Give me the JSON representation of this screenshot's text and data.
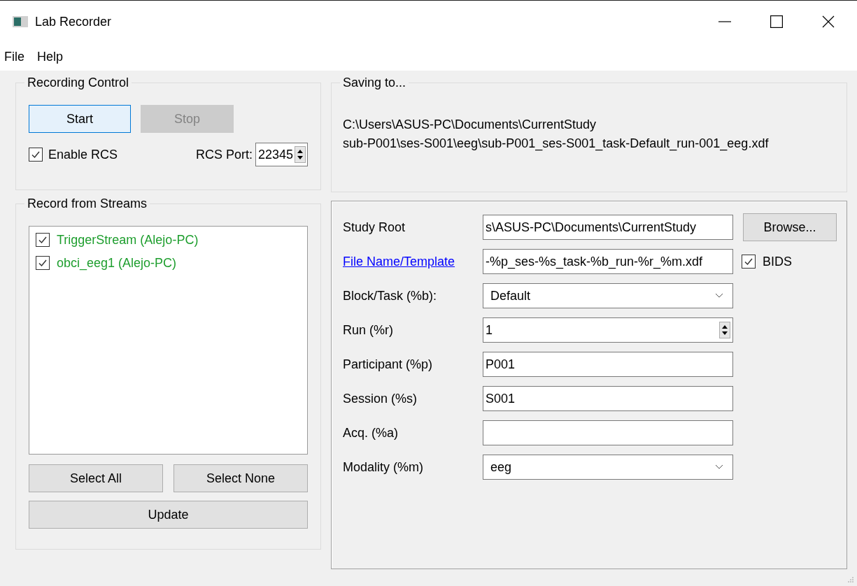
{
  "window": {
    "title": "Lab Recorder"
  },
  "menu": [
    "File",
    "Help"
  ],
  "recording_control": {
    "title": "Recording Control",
    "start": {
      "label": "Start",
      "disabled": false
    },
    "stop": {
      "label": "Stop",
      "disabled": true
    },
    "enable_rcs": {
      "label": "Enable RCS",
      "checked": true
    },
    "rcs_port": {
      "label": "RCS Port:",
      "value": "22345"
    }
  },
  "saving_to": {
    "title": "Saving to...",
    "lines": [
      "C:\\Users\\ASUS-PC\\Documents\\CurrentStudy",
      "sub-P001\\ses-S001\\eeg\\sub-P001_ses-S001_task-Default_run-001_eeg.xdf"
    ]
  },
  "streams": {
    "title": "Record from Streams",
    "items": [
      {
        "label": "TriggerStream (Alejo-PC)",
        "checked": true,
        "color": "#1e9e2e"
      },
      {
        "label": "obci_eeg1 (Alejo-PC)",
        "checked": true,
        "color": "#1e9e2e"
      }
    ],
    "buttons": [
      "Select All",
      "Select None"
    ],
    "update": "Update"
  },
  "settings": {
    "rows": [
      {
        "label": "Study Root",
        "link": false,
        "kind": "text",
        "value": "s\\ASUS-PC\\Documents\\CurrentStudy",
        "extra": {
          "kind": "button",
          "label": "Browse..."
        }
      },
      {
        "label": "File Name/Template",
        "link": true,
        "kind": "text",
        "value": "-%p_ses-%s_task-%b_run-%r_%m.xdf",
        "extra": {
          "kind": "checkbox",
          "label": "BIDS",
          "checked": true
        }
      },
      {
        "label": "Block/Task (%b):",
        "link": false,
        "kind": "combo",
        "value": "Default"
      },
      {
        "label": "Run (%r)",
        "link": false,
        "kind": "spin",
        "value": "1"
      },
      {
        "label": "Participant (%p)",
        "link": false,
        "kind": "text",
        "value": "P001"
      },
      {
        "label": "Session (%s)",
        "link": false,
        "kind": "text",
        "value": "S001"
      },
      {
        "label": "Acq. (%a)",
        "link": false,
        "kind": "text"
      },
      {
        "label": "Modality (%m)",
        "link": false,
        "kind": "combo",
        "value": "eeg"
      }
    ]
  }
}
